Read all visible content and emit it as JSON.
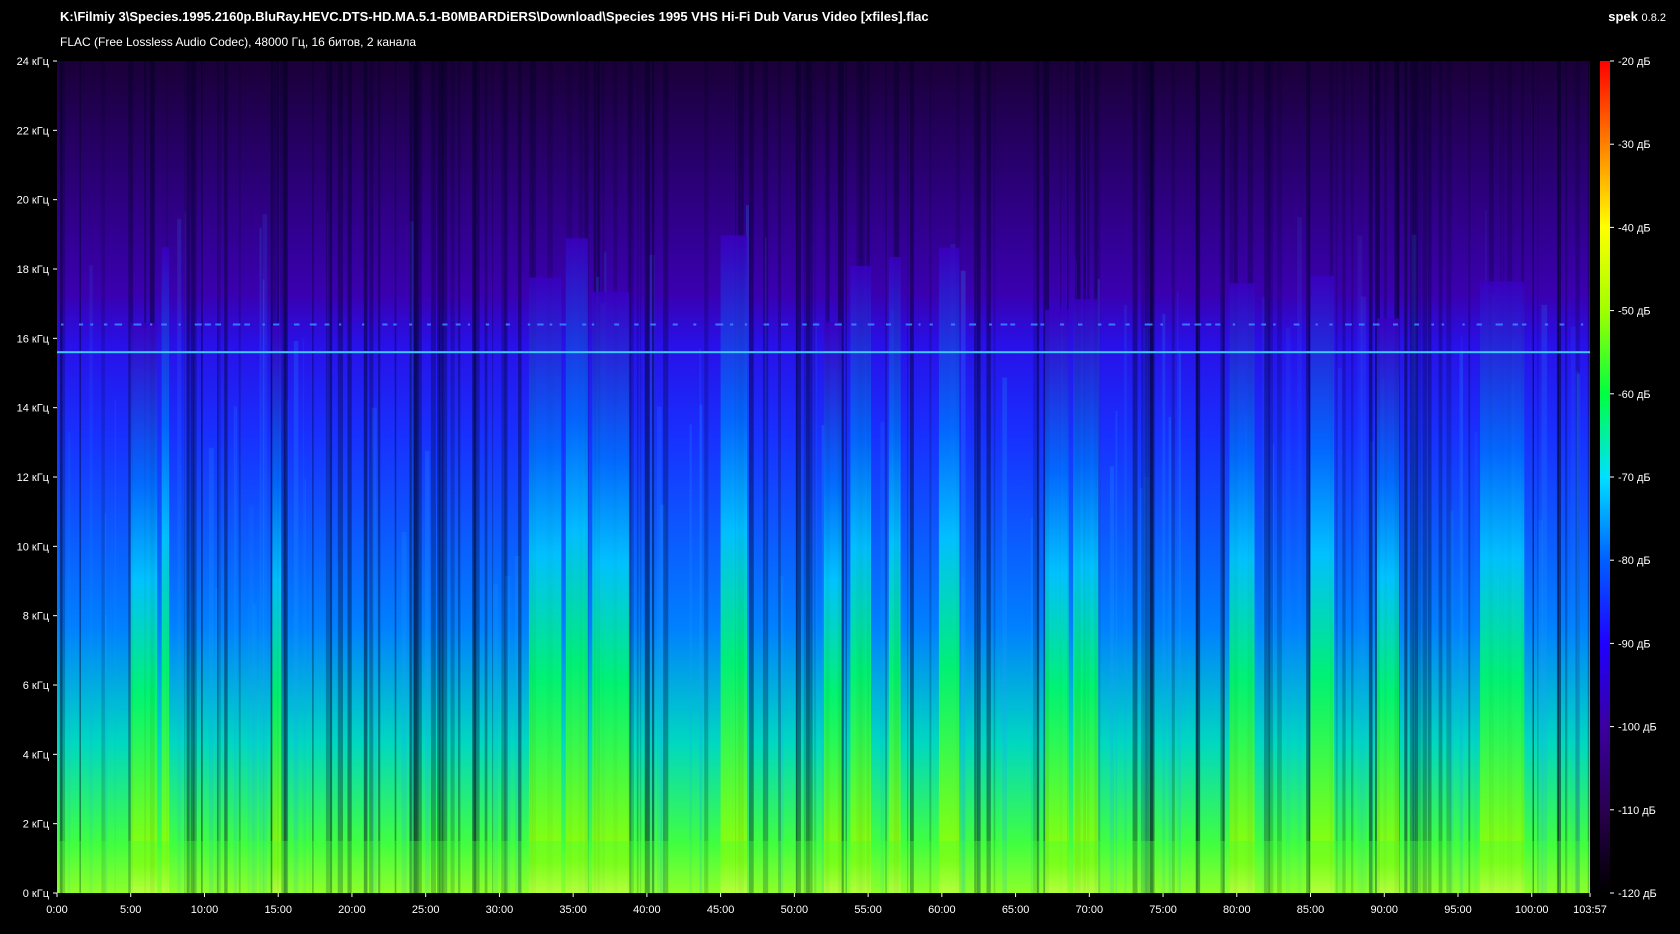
{
  "header": {
    "file_path": "K:\\Filmiy 3\\Species.1995.2160p.BluRay.HEVC.DTS-HD.MA.5.1-B0MBARDiERS\\Download\\Species 1995 VHS Hi-Fi Dub Varus Video [xfiles].flac",
    "audio_info": "FLAC (Free Lossless Audio Codec), 48000 Гц, 16 битов, 2 канала",
    "app_name": "spek",
    "app_version": "0.8.2"
  },
  "chart_data": {
    "type": "heatmap",
    "x_unit": "time (min:sec)",
    "xlim": [
      0,
      103.95
    ],
    "x_ticks": [
      "0:00",
      "5:00",
      "10:00",
      "15:00",
      "20:00",
      "25:00",
      "30:00",
      "35:00",
      "40:00",
      "45:00",
      "50:00",
      "55:00",
      "60:00",
      "65:00",
      "70:00",
      "75:00",
      "80:00",
      "85:00",
      "90:00",
      "95:00",
      "100:00",
      "103:57"
    ],
    "x_tick_values": [
      0,
      5,
      10,
      15,
      20,
      25,
      30,
      35,
      40,
      45,
      50,
      55,
      60,
      65,
      70,
      75,
      80,
      85,
      90,
      95,
      100,
      103.95
    ],
    "ylim": [
      0,
      24
    ],
    "y_ticks": [
      "0 кГц",
      "2 кГц",
      "4 кГц",
      "6 кГц",
      "8 кГц",
      "10 кГц",
      "12 кГц",
      "14 кГц",
      "16 кГц",
      "18 кГц",
      "20 кГц",
      "22 кГц",
      "24 кГц"
    ],
    "y_tick_values": [
      0,
      2,
      4,
      6,
      8,
      10,
      12,
      14,
      16,
      18,
      20,
      22,
      24
    ],
    "colorbar": {
      "range_db": [
        -120,
        -20
      ],
      "ticks": [
        "-20 дБ",
        "-30 дБ",
        "-40 дБ",
        "-50 дБ",
        "-60 дБ",
        "-70 дБ",
        "-80 дБ",
        "-90 дБ",
        "-100 дБ",
        "-110 дБ",
        "-120 дБ"
      ],
      "tick_values": [
        -20,
        -30,
        -40,
        -50,
        -60,
        -70,
        -80,
        -90,
        -100,
        -110,
        -120
      ],
      "colors": [
        "#000000",
        "#2a0050",
        "#3a00a0",
        "#2000ff",
        "#0060ff",
        "#00e0ff",
        "#00ff40",
        "#a0ff00",
        "#ffff00",
        "#ff8000",
        "#ff0000"
      ]
    },
    "features": {
      "constant_line_khz": 15.6,
      "dotted_line_khz": 16.4,
      "loud_segments_min": [
        [
          5.0,
          6.8
        ],
        [
          7.1,
          7.6
        ],
        [
          14.6,
          15.2
        ],
        [
          32.0,
          34.2
        ],
        [
          34.5,
          36.0
        ],
        [
          36.3,
          38.8
        ],
        [
          45.0,
          46.8
        ],
        [
          52.0,
          53.2
        ],
        [
          53.8,
          55.2
        ],
        [
          56.4,
          57.2
        ],
        [
          59.8,
          61.2
        ],
        [
          67.0,
          68.6
        ],
        [
          68.9,
          70.6
        ],
        [
          79.5,
          81.2
        ],
        [
          85.0,
          86.6
        ],
        [
          89.5,
          91.0
        ],
        [
          96.5,
          99.5
        ]
      ]
    }
  }
}
